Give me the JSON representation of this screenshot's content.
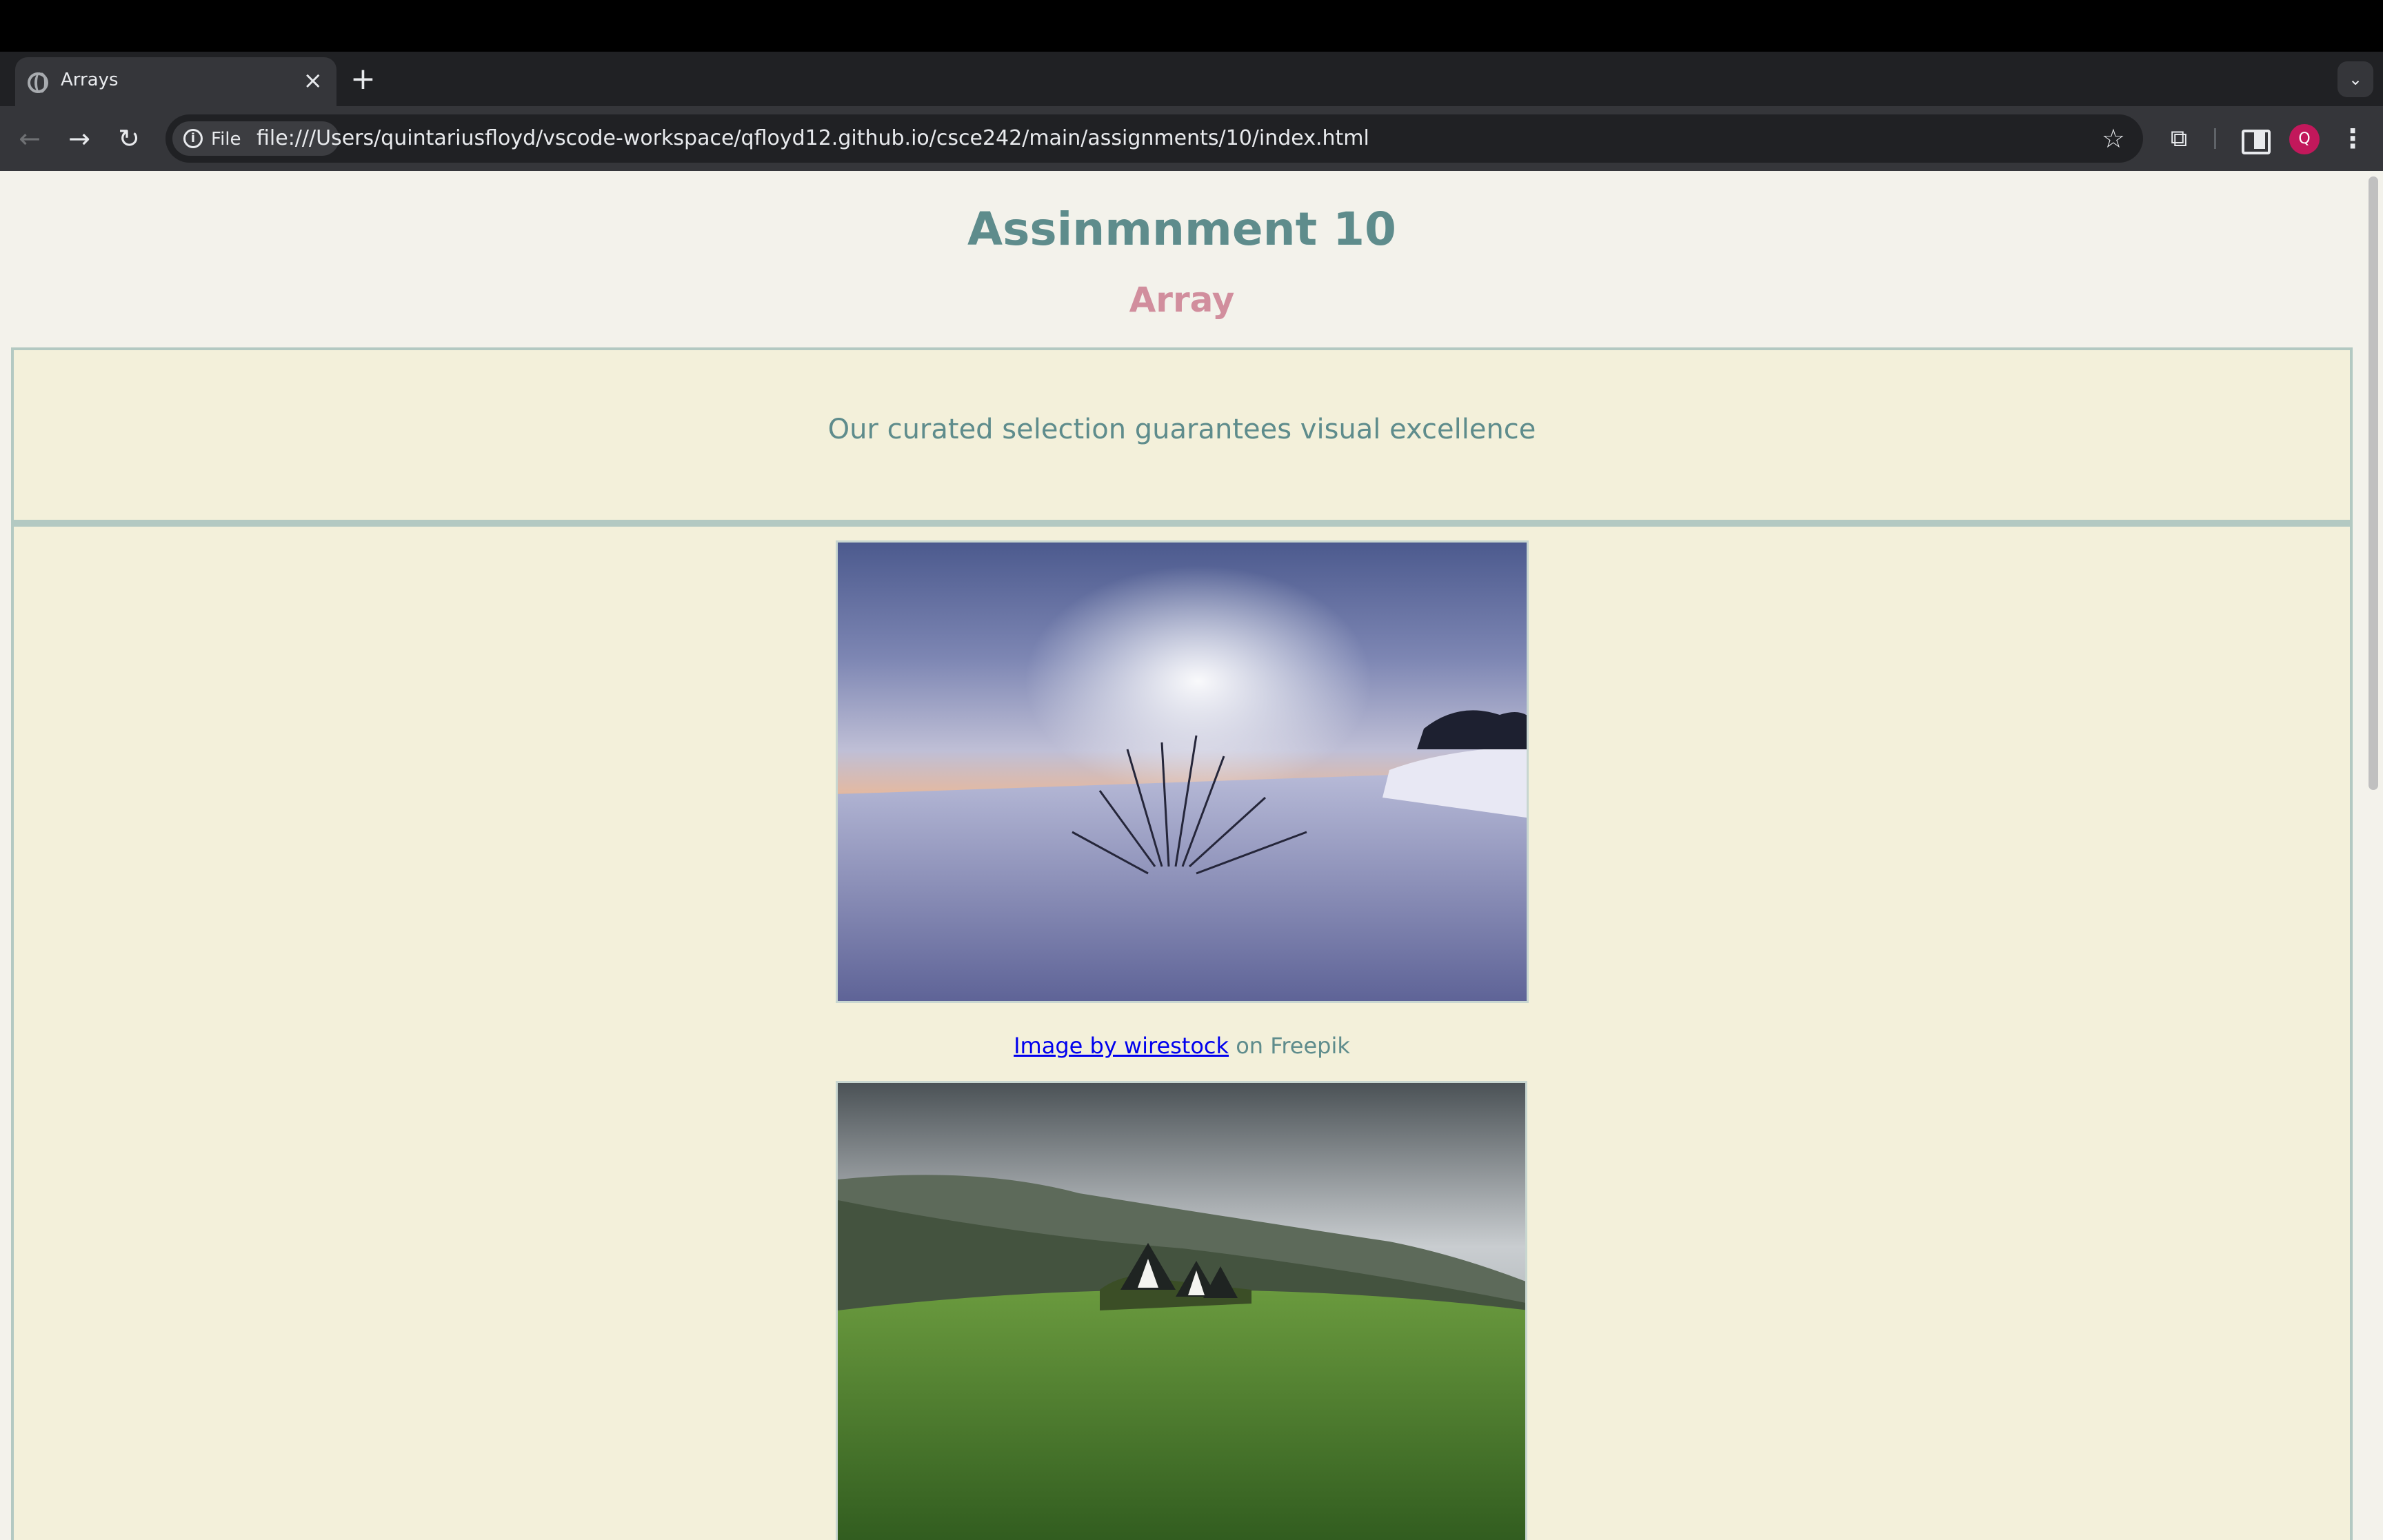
{
  "browser": {
    "tab_title": "Arrays",
    "tab_close": "×",
    "new_tab": "+",
    "tab_list": "⌄",
    "chip_label": "File",
    "url": "file:///Users/quintariusfloyd/vscode-workspace/qfloyd12.github.io/csce242/main/assignments/10/index.html",
    "avatar_letter": "Q"
  },
  "page": {
    "title": "Assinmnment 10",
    "subtitle": "Array",
    "banner_text": "Our curated selection guarantees visual excellence",
    "images": [
      {
        "caption_link": "Image by wirestock",
        "caption_suffix": " on Freepik"
      },
      {}
    ]
  }
}
